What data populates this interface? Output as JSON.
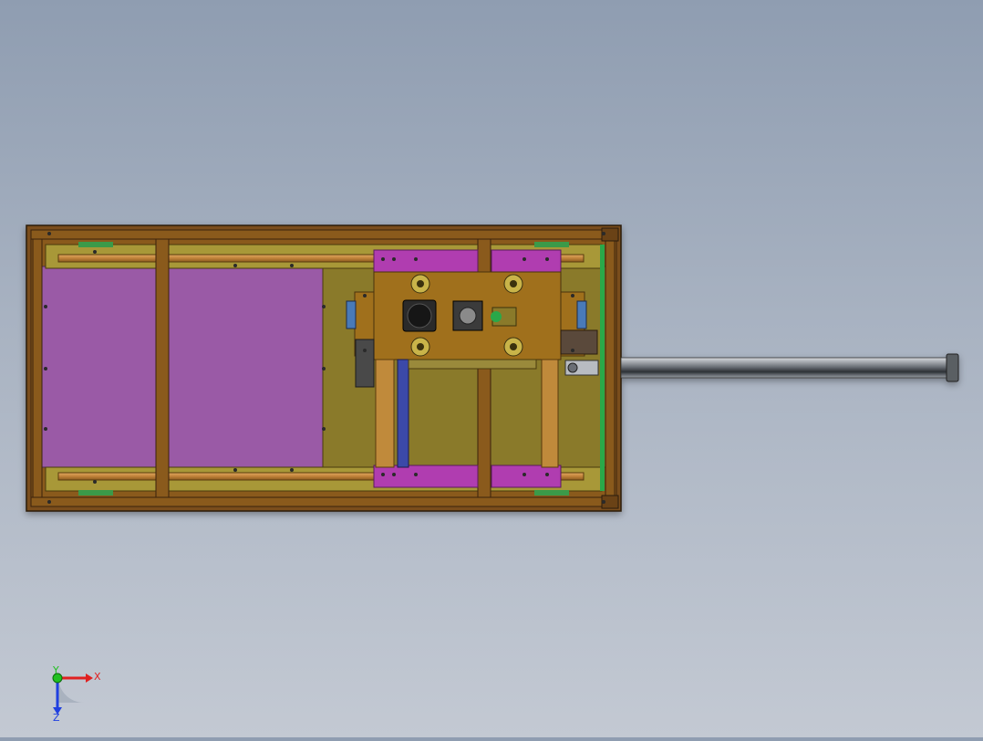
{
  "viewport": {
    "background_top": "#8f9db1",
    "background_bottom": "#c3c9d3"
  },
  "model": {
    "frame_color": "#8a5a1e",
    "panel_color": "#9a5aa6",
    "base_color": "#8a7a2a",
    "rail_color": "#c88a3a",
    "bracket_color": "#b03cb0",
    "accent_green": "#2aa84a",
    "accent_blue": "#4a7ab8",
    "rod_color": "#7a7f86"
  },
  "triad": {
    "x_label": "X",
    "y_label": "Y",
    "z_label": "Z",
    "x_color": "#e02020",
    "y_color": "#20c020",
    "z_color": "#2040e0"
  }
}
